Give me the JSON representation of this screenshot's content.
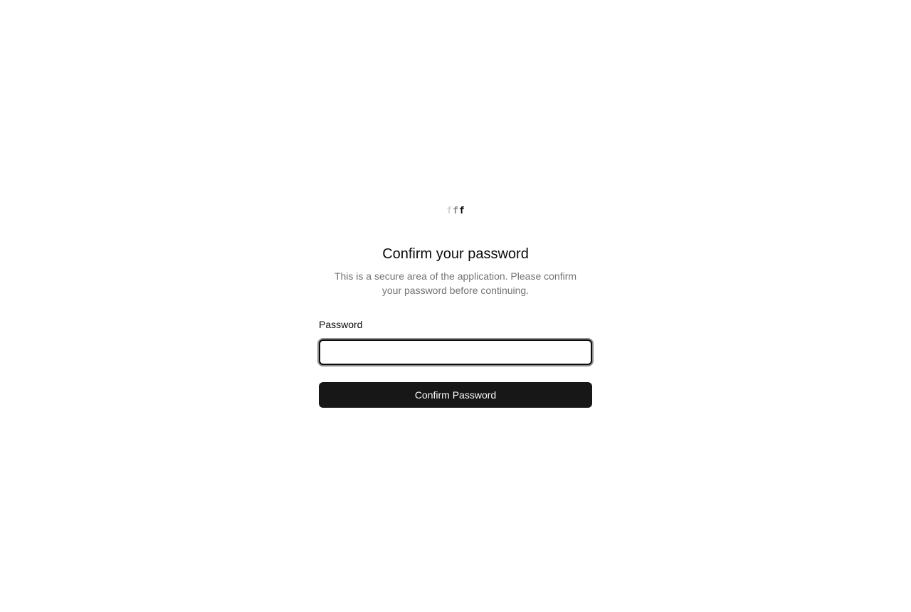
{
  "logo": {
    "letters": [
      "f",
      "f",
      "f"
    ],
    "colors": [
      "#d4d4d4",
      "#8a8a8a",
      "#0a0a0a"
    ]
  },
  "heading": {
    "title": "Confirm your password",
    "subtitle": "This is a secure area of the application. Please confirm your password before continuing."
  },
  "form": {
    "password_label": "Password",
    "password_value": "",
    "submit_label": "Confirm Password"
  },
  "colors": {
    "button_bg": "#171717",
    "button_text": "#fafafa",
    "muted_text": "#737373",
    "focus_ring": "#8f8f8f"
  }
}
